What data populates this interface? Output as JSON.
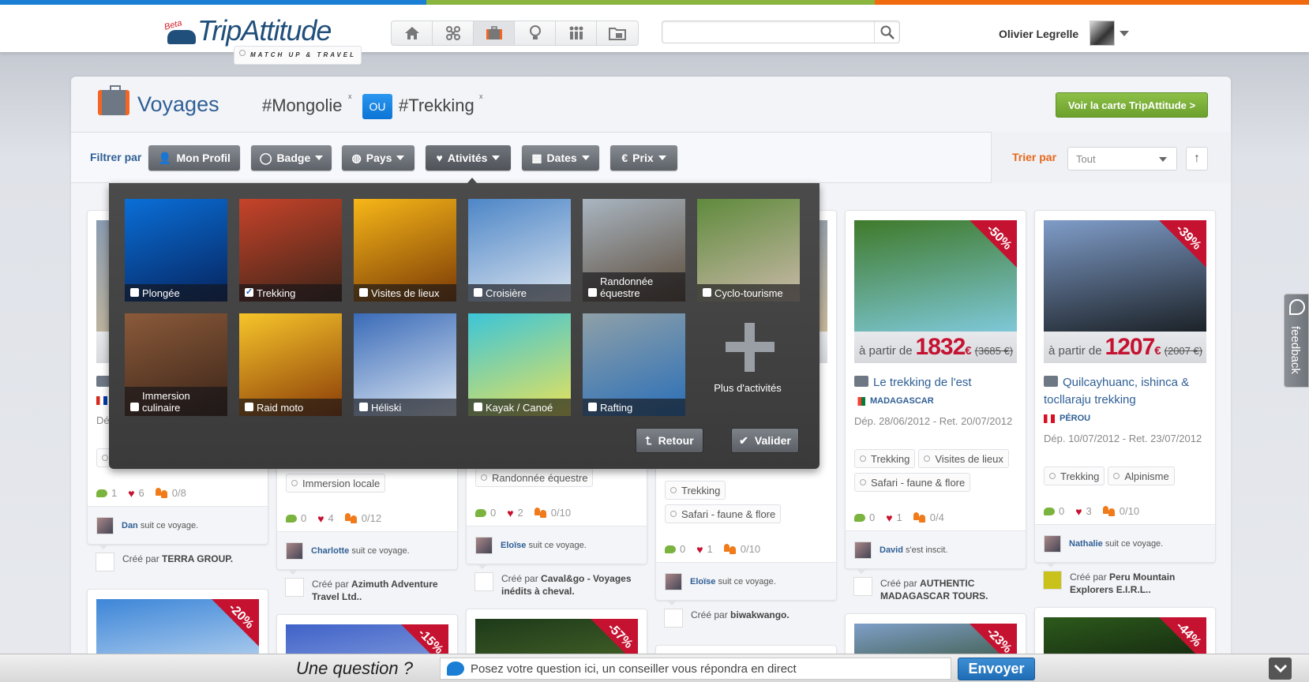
{
  "colors": {
    "bar_blue": "#1a7fd4",
    "bar_green": "#8ab53f",
    "bar_orange": "#f26a10",
    "brand_blue": "#2f5f95",
    "accent_red": "#c41230",
    "accent_orange": "#e8671a",
    "map_green": "#7cb13a"
  },
  "header": {
    "logo_text": "TripAttitude",
    "logo_badge": "Beta",
    "logo_tagline": "MATCH UP & TRAVEL",
    "nav": [
      {
        "icon": "home-icon"
      },
      {
        "icon": "network-icon"
      },
      {
        "icon": "suitcase-icon",
        "active": true
      },
      {
        "icon": "lightbulb-icon"
      },
      {
        "icon": "people-icon"
      },
      {
        "icon": "folder-icon"
      }
    ],
    "search": {
      "value": "",
      "placeholder": ""
    },
    "user_name": "Olivier Legrelle"
  },
  "page": {
    "title": "Voyages",
    "tags": [
      "#Mongolie",
      "#Trekking"
    ],
    "tag_remove": "x",
    "operator": "OU",
    "map_button": "Voir la carte TripAttitude >"
  },
  "filters": {
    "label": "Filtrer par",
    "buttons": [
      {
        "label": "Mon Profil",
        "icon": "user-icon"
      },
      {
        "label": "Badge",
        "icon": "badge-icon"
      },
      {
        "label": "Pays",
        "icon": "globe-icon"
      },
      {
        "label": "Ativités",
        "icon": "heart-icon",
        "open": true
      },
      {
        "label": "Dates",
        "icon": "calendar-icon"
      },
      {
        "label": "Prix",
        "icon": "euro-icon"
      }
    ],
    "sort_label": "Trier par",
    "sort_value": "Tout",
    "sort_direction": "↑"
  },
  "activities": {
    "items": [
      {
        "label": "Plongée",
        "checked": false,
        "colors": [
          "#0a6fd8",
          "#06245e"
        ]
      },
      {
        "label": "Trekking",
        "checked": true,
        "colors": [
          "#c7432a",
          "#3b2418"
        ]
      },
      {
        "label": "Visites de lieux",
        "checked": false,
        "colors": [
          "#f7b718",
          "#7a3a06"
        ]
      },
      {
        "label": "Croisière",
        "checked": false,
        "colors": [
          "#4d86c7",
          "#d8e2ee"
        ]
      },
      {
        "label": "Randonnée équestre",
        "checked": false,
        "colors": [
          "#a9b6c2",
          "#5b4a38"
        ]
      },
      {
        "label": "Cyclo-tourisme",
        "checked": false,
        "colors": [
          "#5f8a3c",
          "#c9b9a8"
        ]
      },
      {
        "label": "Immersion culinaire",
        "checked": false,
        "colors": [
          "#8b5a3a",
          "#3a2418"
        ]
      },
      {
        "label": "Raid moto",
        "checked": false,
        "colors": [
          "#f7c52a",
          "#8a3c08"
        ]
      },
      {
        "label": "Héliski",
        "checked": false,
        "colors": [
          "#3a6bb8",
          "#dce6f2"
        ]
      },
      {
        "label": "Kayak / Canoé",
        "checked": false,
        "colors": [
          "#3cc5d8",
          "#e9e25a"
        ]
      },
      {
        "label": "Rafting",
        "checked": false,
        "colors": [
          "#8fa0a8",
          "#2a6fb8"
        ]
      }
    ],
    "more_label": "Plus d'activités",
    "back_button": "Retour",
    "confirm_button": "Valider"
  },
  "columns": [
    {
      "cards": [
        {
          "flag": [
            "#d52b1e",
            "#ffffff",
            "#0039a6"
          ],
          "dates": "Dép.",
          "tags": [
            ""
          ],
          "stats": {
            "comments": "1",
            "likes": "6",
            "participants": "0/8"
          },
          "follow": {
            "user": "Dan",
            "text": "suit ce voyage."
          },
          "creator": {
            "prefix": "Créé par",
            "name": "TERRA GROUP."
          }
        },
        {
          "discount": "-20%",
          "image": [
            "#3d86d8",
            "#c6dcf2"
          ]
        }
      ]
    },
    {
      "cards": [
        {
          "tags": [
            "Immersion locale"
          ],
          "stats": {
            "comments": "0",
            "likes": "4",
            "participants": "0/12"
          },
          "follow": {
            "user": "Charlotte",
            "text": "suit ce voyage."
          },
          "creator": {
            "prefix": "Créé par",
            "name": "Azimuth Adventure Travel Ltd.."
          }
        },
        {
          "discount": "-15%",
          "image": [
            "#3f62c8",
            "#8fa6e0"
          ]
        }
      ]
    },
    {
      "cards": [
        {
          "tags": [
            "Randonnée équestre"
          ],
          "stats": {
            "comments": "0",
            "likes": "2",
            "participants": "0/10"
          },
          "follow": {
            "user": "Eloïse",
            "text": "suit ce voyage."
          },
          "creator": {
            "prefix": "Créé par",
            "name": "Caval&go - Voyages inédits à cheval."
          }
        },
        {
          "discount": "-57%",
          "image": [
            "#1d3a1a",
            "#4c6a2a"
          ]
        }
      ]
    },
    {
      "cards": [
        {
          "tags": [
            "Trekking",
            "Safari - faune & flore"
          ],
          "stats": {
            "comments": "0",
            "likes": "1",
            "participants": "0/10"
          },
          "follow": {
            "user": "Eloïse",
            "text": "suit ce voyage."
          },
          "creator": {
            "prefix": "Créé par",
            "name": "biwakwango."
          }
        },
        {
          "discount": "",
          "image": [
            "#d8c2c6",
            "#f2e6e8"
          ]
        }
      ]
    },
    {
      "cards": [
        {
          "discount": "-50%",
          "image": [
            "#3f7a2a",
            "#7ec8d8"
          ],
          "price_prefix": "à partir de",
          "price": "1832",
          "currency": "€",
          "old_price": "(3685 €)",
          "title": "Le trekking de l'est",
          "country": "MADAGASCAR",
          "flag": [
            "#ffffff",
            "#fc3d32",
            "#007e3a"
          ],
          "dates": "Dép. 28/06/2012 - Ret. 20/07/2012",
          "tags": [
            "Trekking",
            "Visites de lieux",
            "Safari - faune & flore"
          ],
          "stats": {
            "comments": "0",
            "likes": "1",
            "participants": "0/4"
          },
          "follow": {
            "user": "David",
            "text": "s'est inscit."
          },
          "creator": {
            "prefix": "Créé par",
            "name": "AUTHENTIC MADAGASCAR TOURS."
          }
        },
        {
          "discount": "-23%",
          "image": [
            "#7f9fc8",
            "#2d4a28"
          ]
        }
      ]
    },
    {
      "cards": [
        {
          "discount": "-39%",
          "image": [
            "#7f9cc8",
            "#1c2228"
          ],
          "price_prefix": "à partir de",
          "price": "1207",
          "currency": "€",
          "old_price": "(2007 €)",
          "title": "Quilcayhuanc, ishinca & tocllaraju trekking",
          "country": "PÉROU",
          "flag": [
            "#d91023",
            "#ffffff",
            "#d91023"
          ],
          "dates": "Dép. 10/07/2012 - Ret. 23/07/2012",
          "tags": [
            "Trekking",
            "Alpinisme"
          ],
          "stats": {
            "comments": "0",
            "likes": "3",
            "participants": "0/10"
          },
          "follow": {
            "user": "Nathalie",
            "text": "suit ce voyage."
          },
          "creator": {
            "prefix": "Créé par",
            "name": "Peru Mountain Explorers E.I.R.L.."
          }
        },
        {
          "discount": "-44%",
          "image": [
            "#2c5a1c",
            "#0f1a0c"
          ]
        }
      ]
    }
  ],
  "feedback": {
    "label": "feedback"
  },
  "chat": {
    "question": "Une question ?",
    "placeholder": "Posez votre question ici, un conseiller vous répondra en direct",
    "value": "",
    "send": "Envoyer"
  }
}
